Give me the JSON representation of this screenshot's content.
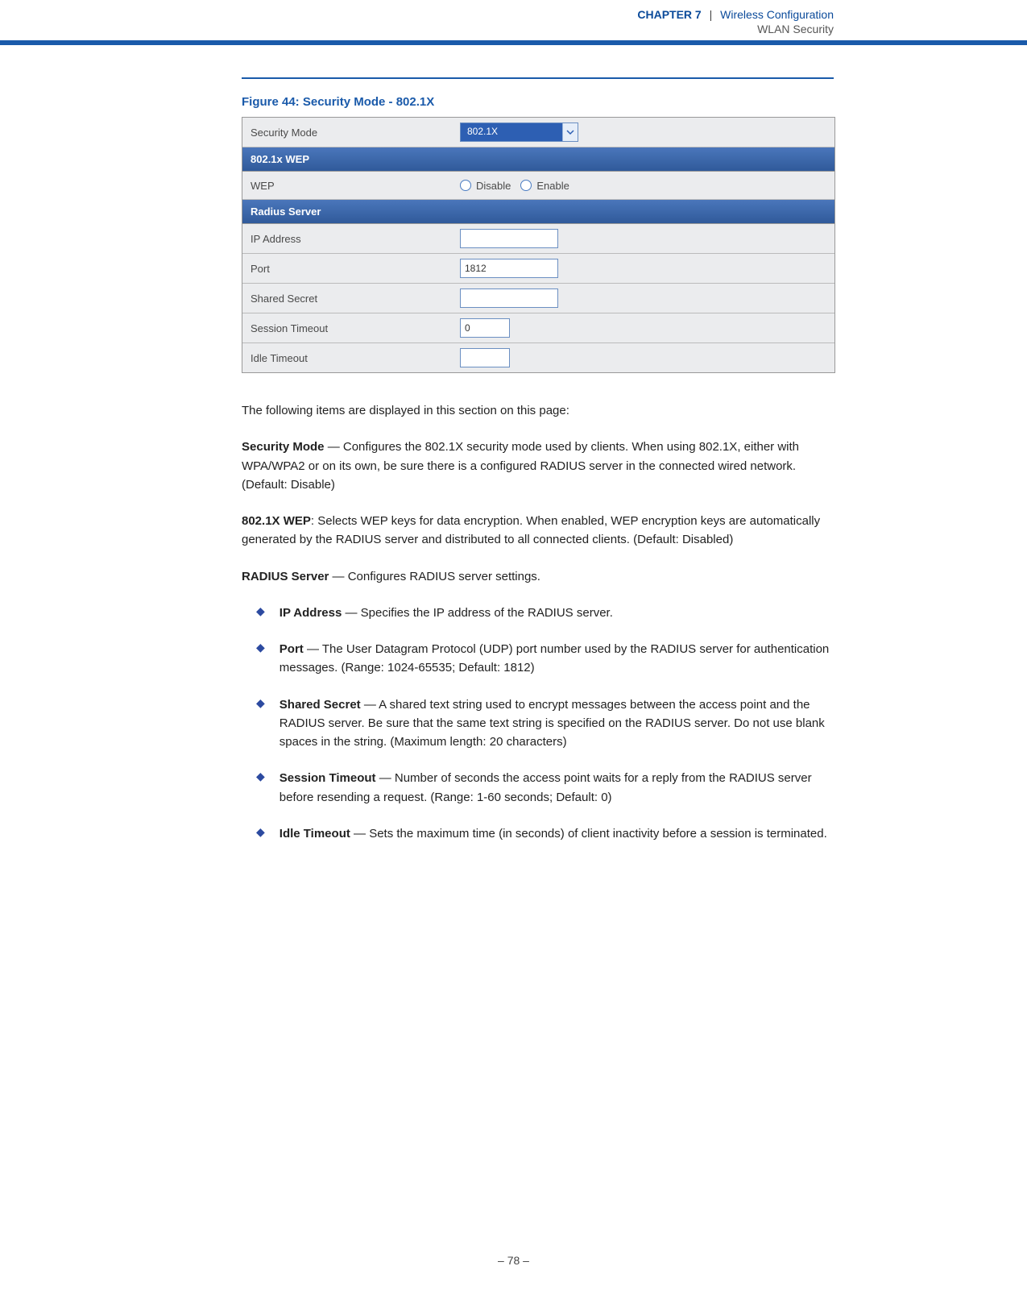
{
  "header": {
    "chapter_label": "CHAPTER 7",
    "separator": "|",
    "chapter_title": "Wireless Configuration",
    "section_title": "WLAN Security"
  },
  "figure_caption": "Figure 44:  Security Mode - 802.1X",
  "config": {
    "security_mode_label": "Security Mode",
    "security_mode_value": "802.1X",
    "wep_header": "802.1x WEP",
    "wep_label": "WEP",
    "wep_disable": "Disable",
    "wep_enable": "Enable",
    "radius_header": "Radius Server",
    "ip_label": "IP Address",
    "ip_value": "",
    "port_label": "Port",
    "port_value": "1812",
    "secret_label": "Shared Secret",
    "secret_value": "",
    "session_label": "Session Timeout",
    "session_value": "0",
    "idle_label": "Idle Timeout",
    "idle_value": ""
  },
  "body": {
    "intro": "The following items are displayed in this section on this page:",
    "p1_strong": "Security Mode",
    "p1_text": " — Configures the 802.1X security mode used by clients. When using 802.1X, either with WPA/WPA2 or on its own, be sure there is a configured RADIUS server in the connected wired network. (Default: Disable)",
    "p2_strong": "802.1X WEP",
    "p2_text": ": Selects WEP keys for data encryption. When enabled, WEP encryption keys are automatically generated by the RADIUS server and distributed to all connected clients. (Default: Disabled)",
    "p3_strong": "RADIUS Server",
    "p3_text": " — Configures RADIUS server settings.",
    "bullets": [
      {
        "strong": "IP Address",
        "text": " — Specifies the IP address of the RADIUS server."
      },
      {
        "strong": "Port",
        "text": " — The User Datagram Protocol (UDP) port number used by the RADIUS server for authentication messages. (Range: 1024-65535; Default: 1812)"
      },
      {
        "strong": "Shared Secret",
        "text": " — A shared text string used to encrypt messages between the access point and the RADIUS server. Be sure that the same text string is specified on the RADIUS server. Do not use blank spaces in the string. (Maximum length: 20 characters)"
      },
      {
        "strong": "Session Timeout",
        "text": " — Number of seconds the access point waits for a reply from the RADIUS server before resending a request. (Range: 1-60 seconds; Default: 0)"
      },
      {
        "strong": "Idle Timeout",
        "text": " — Sets the maximum time (in seconds) of client inactivity before a session is terminated."
      }
    ]
  },
  "footer": "–  78  –"
}
